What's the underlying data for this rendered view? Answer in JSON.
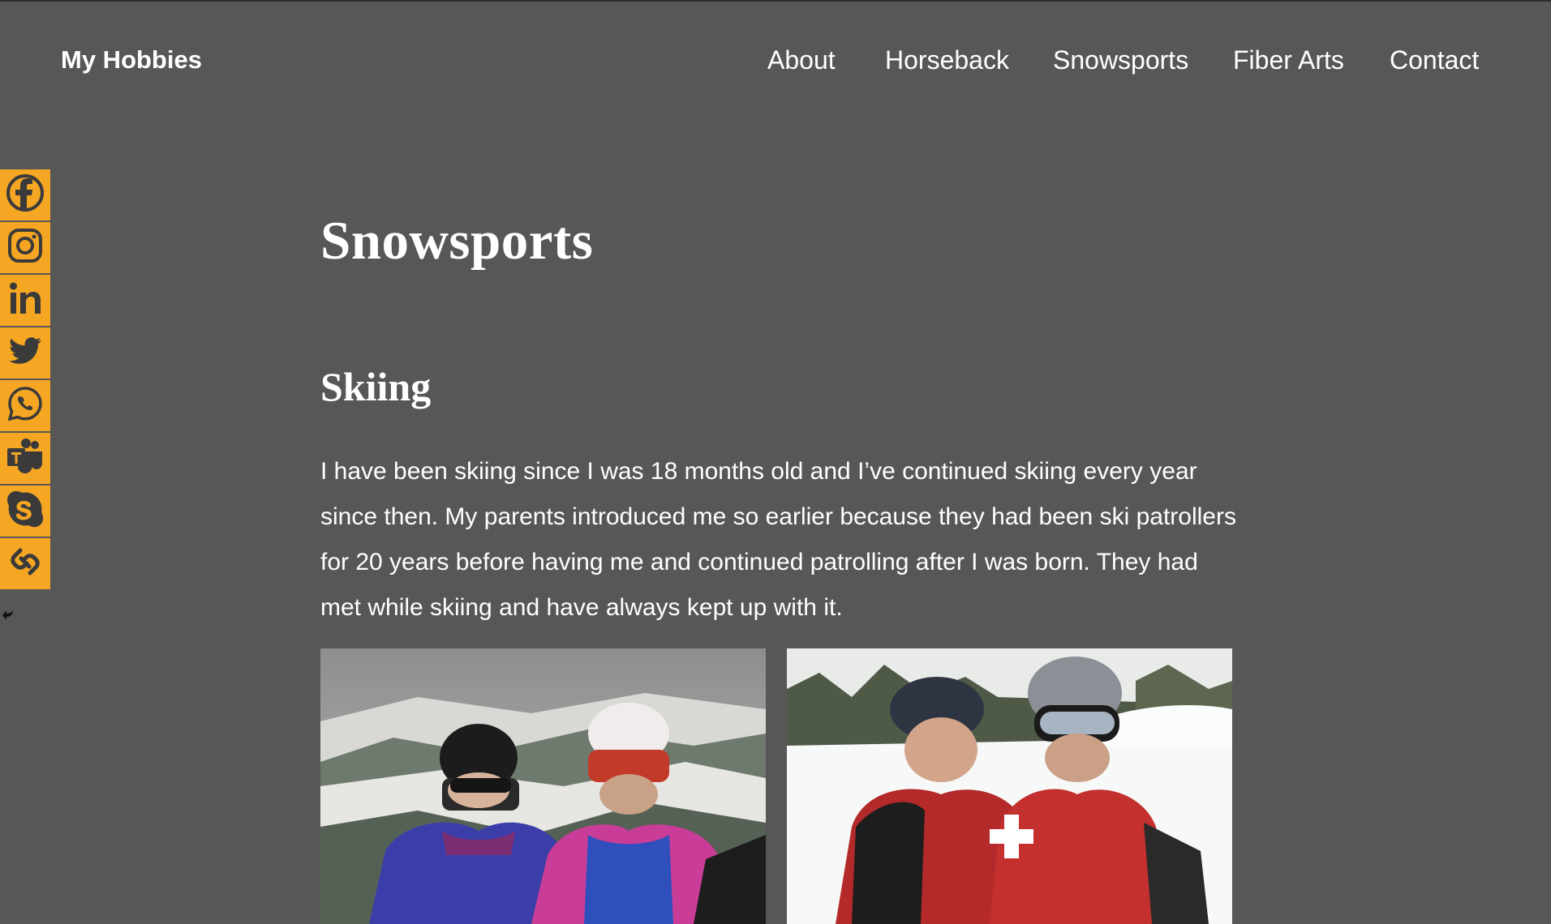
{
  "site": {
    "title": "My Hobbies"
  },
  "nav": {
    "items": [
      "About",
      "Horseback",
      "Snowsports",
      "Fiber Arts",
      "Contact"
    ]
  },
  "share_bar": {
    "buttons": [
      {
        "icon": "facebook-icon"
      },
      {
        "icon": "instagram-icon"
      },
      {
        "icon": "linkedin-icon"
      },
      {
        "icon": "twitter-icon"
      },
      {
        "icon": "whatsapp-icon"
      },
      {
        "icon": "teams-icon"
      },
      {
        "icon": "skype-icon"
      },
      {
        "icon": "copy-link-icon"
      }
    ],
    "hide_icon": "hide-arrow-icon",
    "accent_color": "#f5a623"
  },
  "page": {
    "title": "Snowsports",
    "section_title": "Skiing",
    "paragraph": "I have been skiing since I was 18 months old and I’ve continued skiing every year since then. My parents introduced me so earlier because they had been ski patrollers for 20 years before having me and continued patrolling after I was born. They had met while skiing and have always kept up with it."
  },
  "colors": {
    "background": "#575757",
    "text": "#ffffff"
  }
}
